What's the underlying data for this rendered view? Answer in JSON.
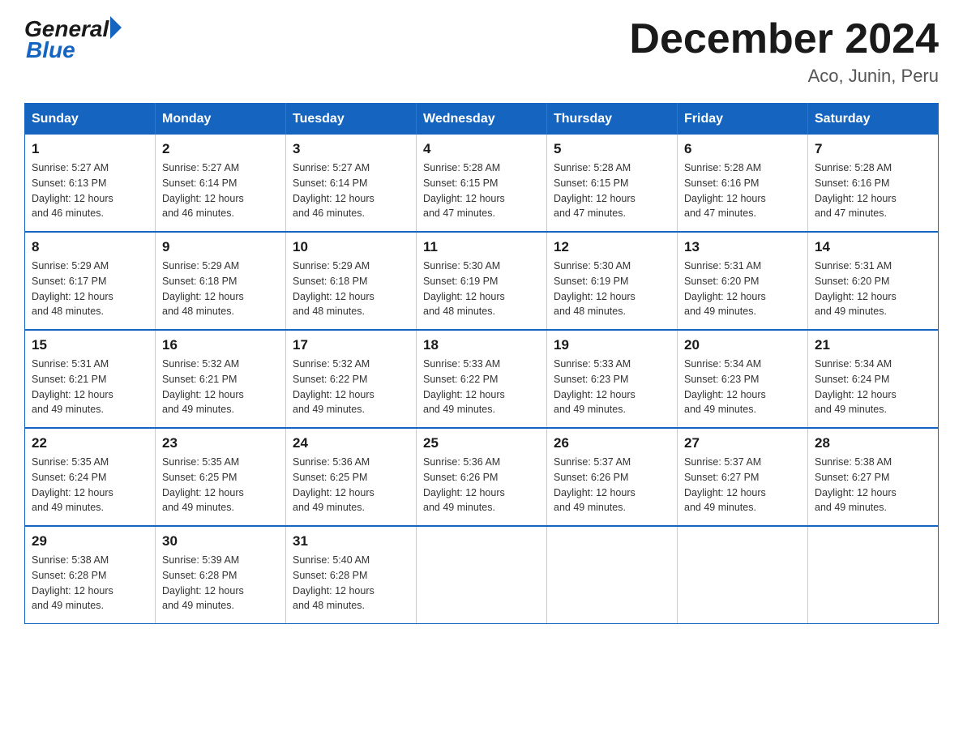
{
  "logo": {
    "general": "General",
    "blue": "Blue"
  },
  "title": "December 2024",
  "subtitle": "Aco, Junin, Peru",
  "weekdays": [
    "Sunday",
    "Monday",
    "Tuesday",
    "Wednesday",
    "Thursday",
    "Friday",
    "Saturday"
  ],
  "weeks": [
    [
      {
        "day": "1",
        "sunrise": "5:27 AM",
        "sunset": "6:13 PM",
        "daylight": "12 hours and 46 minutes."
      },
      {
        "day": "2",
        "sunrise": "5:27 AM",
        "sunset": "6:14 PM",
        "daylight": "12 hours and 46 minutes."
      },
      {
        "day": "3",
        "sunrise": "5:27 AM",
        "sunset": "6:14 PM",
        "daylight": "12 hours and 46 minutes."
      },
      {
        "day": "4",
        "sunrise": "5:28 AM",
        "sunset": "6:15 PM",
        "daylight": "12 hours and 47 minutes."
      },
      {
        "day": "5",
        "sunrise": "5:28 AM",
        "sunset": "6:15 PM",
        "daylight": "12 hours and 47 minutes."
      },
      {
        "day": "6",
        "sunrise": "5:28 AM",
        "sunset": "6:16 PM",
        "daylight": "12 hours and 47 minutes."
      },
      {
        "day": "7",
        "sunrise": "5:28 AM",
        "sunset": "6:16 PM",
        "daylight": "12 hours and 47 minutes."
      }
    ],
    [
      {
        "day": "8",
        "sunrise": "5:29 AM",
        "sunset": "6:17 PM",
        "daylight": "12 hours and 48 minutes."
      },
      {
        "day": "9",
        "sunrise": "5:29 AM",
        "sunset": "6:18 PM",
        "daylight": "12 hours and 48 minutes."
      },
      {
        "day": "10",
        "sunrise": "5:29 AM",
        "sunset": "6:18 PM",
        "daylight": "12 hours and 48 minutes."
      },
      {
        "day": "11",
        "sunrise": "5:30 AM",
        "sunset": "6:19 PM",
        "daylight": "12 hours and 48 minutes."
      },
      {
        "day": "12",
        "sunrise": "5:30 AM",
        "sunset": "6:19 PM",
        "daylight": "12 hours and 48 minutes."
      },
      {
        "day": "13",
        "sunrise": "5:31 AM",
        "sunset": "6:20 PM",
        "daylight": "12 hours and 49 minutes."
      },
      {
        "day": "14",
        "sunrise": "5:31 AM",
        "sunset": "6:20 PM",
        "daylight": "12 hours and 49 minutes."
      }
    ],
    [
      {
        "day": "15",
        "sunrise": "5:31 AM",
        "sunset": "6:21 PM",
        "daylight": "12 hours and 49 minutes."
      },
      {
        "day": "16",
        "sunrise": "5:32 AM",
        "sunset": "6:21 PM",
        "daylight": "12 hours and 49 minutes."
      },
      {
        "day": "17",
        "sunrise": "5:32 AM",
        "sunset": "6:22 PM",
        "daylight": "12 hours and 49 minutes."
      },
      {
        "day": "18",
        "sunrise": "5:33 AM",
        "sunset": "6:22 PM",
        "daylight": "12 hours and 49 minutes."
      },
      {
        "day": "19",
        "sunrise": "5:33 AM",
        "sunset": "6:23 PM",
        "daylight": "12 hours and 49 minutes."
      },
      {
        "day": "20",
        "sunrise": "5:34 AM",
        "sunset": "6:23 PM",
        "daylight": "12 hours and 49 minutes."
      },
      {
        "day": "21",
        "sunrise": "5:34 AM",
        "sunset": "6:24 PM",
        "daylight": "12 hours and 49 minutes."
      }
    ],
    [
      {
        "day": "22",
        "sunrise": "5:35 AM",
        "sunset": "6:24 PM",
        "daylight": "12 hours and 49 minutes."
      },
      {
        "day": "23",
        "sunrise": "5:35 AM",
        "sunset": "6:25 PM",
        "daylight": "12 hours and 49 minutes."
      },
      {
        "day": "24",
        "sunrise": "5:36 AM",
        "sunset": "6:25 PM",
        "daylight": "12 hours and 49 minutes."
      },
      {
        "day": "25",
        "sunrise": "5:36 AM",
        "sunset": "6:26 PM",
        "daylight": "12 hours and 49 minutes."
      },
      {
        "day": "26",
        "sunrise": "5:37 AM",
        "sunset": "6:26 PM",
        "daylight": "12 hours and 49 minutes."
      },
      {
        "day": "27",
        "sunrise": "5:37 AM",
        "sunset": "6:27 PM",
        "daylight": "12 hours and 49 minutes."
      },
      {
        "day": "28",
        "sunrise": "5:38 AM",
        "sunset": "6:27 PM",
        "daylight": "12 hours and 49 minutes."
      }
    ],
    [
      {
        "day": "29",
        "sunrise": "5:38 AM",
        "sunset": "6:28 PM",
        "daylight": "12 hours and 49 minutes."
      },
      {
        "day": "30",
        "sunrise": "5:39 AM",
        "sunset": "6:28 PM",
        "daylight": "12 hours and 49 minutes."
      },
      {
        "day": "31",
        "sunrise": "5:40 AM",
        "sunset": "6:28 PM",
        "daylight": "12 hours and 48 minutes."
      },
      null,
      null,
      null,
      null
    ]
  ],
  "labels": {
    "sunrise": "Sunrise:",
    "sunset": "Sunset:",
    "daylight": "Daylight: 12 hours"
  }
}
